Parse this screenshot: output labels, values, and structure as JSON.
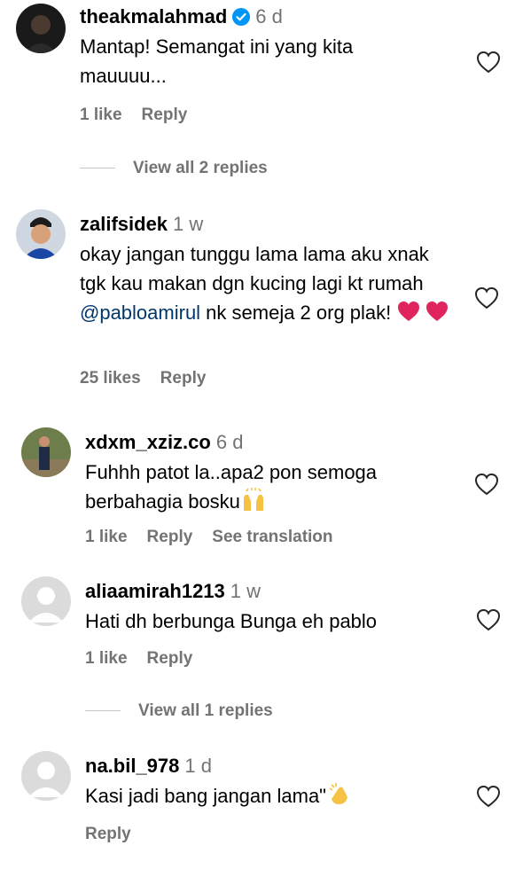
{
  "colors": {
    "text": "#000000",
    "muted": "#737373",
    "link": "#00376b",
    "verified": "#0095f6",
    "heart_emoji": "#e0245e"
  },
  "comments": [
    {
      "username": "theakmalahmad",
      "verified": true,
      "time": "6 d",
      "text": "Mantap! Semangat ini yang kita mauuuu...",
      "likes": "1 like",
      "reply": "Reply",
      "view_replies": "View all 2 replies"
    },
    {
      "username": "zalifsidek",
      "time": "1 w",
      "text_before": "okay jangan tunggu lama lama aku xnak tgk kau makan dgn kucing lagi kt rumah ",
      "mention": "@pabloamirul",
      "text_after": " nk semeja 2 org plak! ",
      "emoji": "red-heart-emoji x2",
      "likes": "25 likes",
      "reply": "Reply"
    },
    {
      "username": "xdxm_xziz.co",
      "time": "6 d",
      "text": "Fuhhh patot la..apa2 pon semoga berbahagia bosku",
      "emoji": "raising-hands-emoji",
      "likes": "1 like",
      "reply": "Reply",
      "translation": "See translation"
    },
    {
      "username": "aliaamirah1213",
      "time": "1 w",
      "text": "Hati dh berbunga Bunga eh pablo",
      "likes": "1 like",
      "reply": "Reply",
      "view_replies": "View all 1 replies"
    },
    {
      "username": "na.bil_978",
      "time": "1 d",
      "text": "Kasi jadi bang jangan lama\"",
      "emoji": "clapping-hands-emoji",
      "reply": "Reply"
    }
  ]
}
